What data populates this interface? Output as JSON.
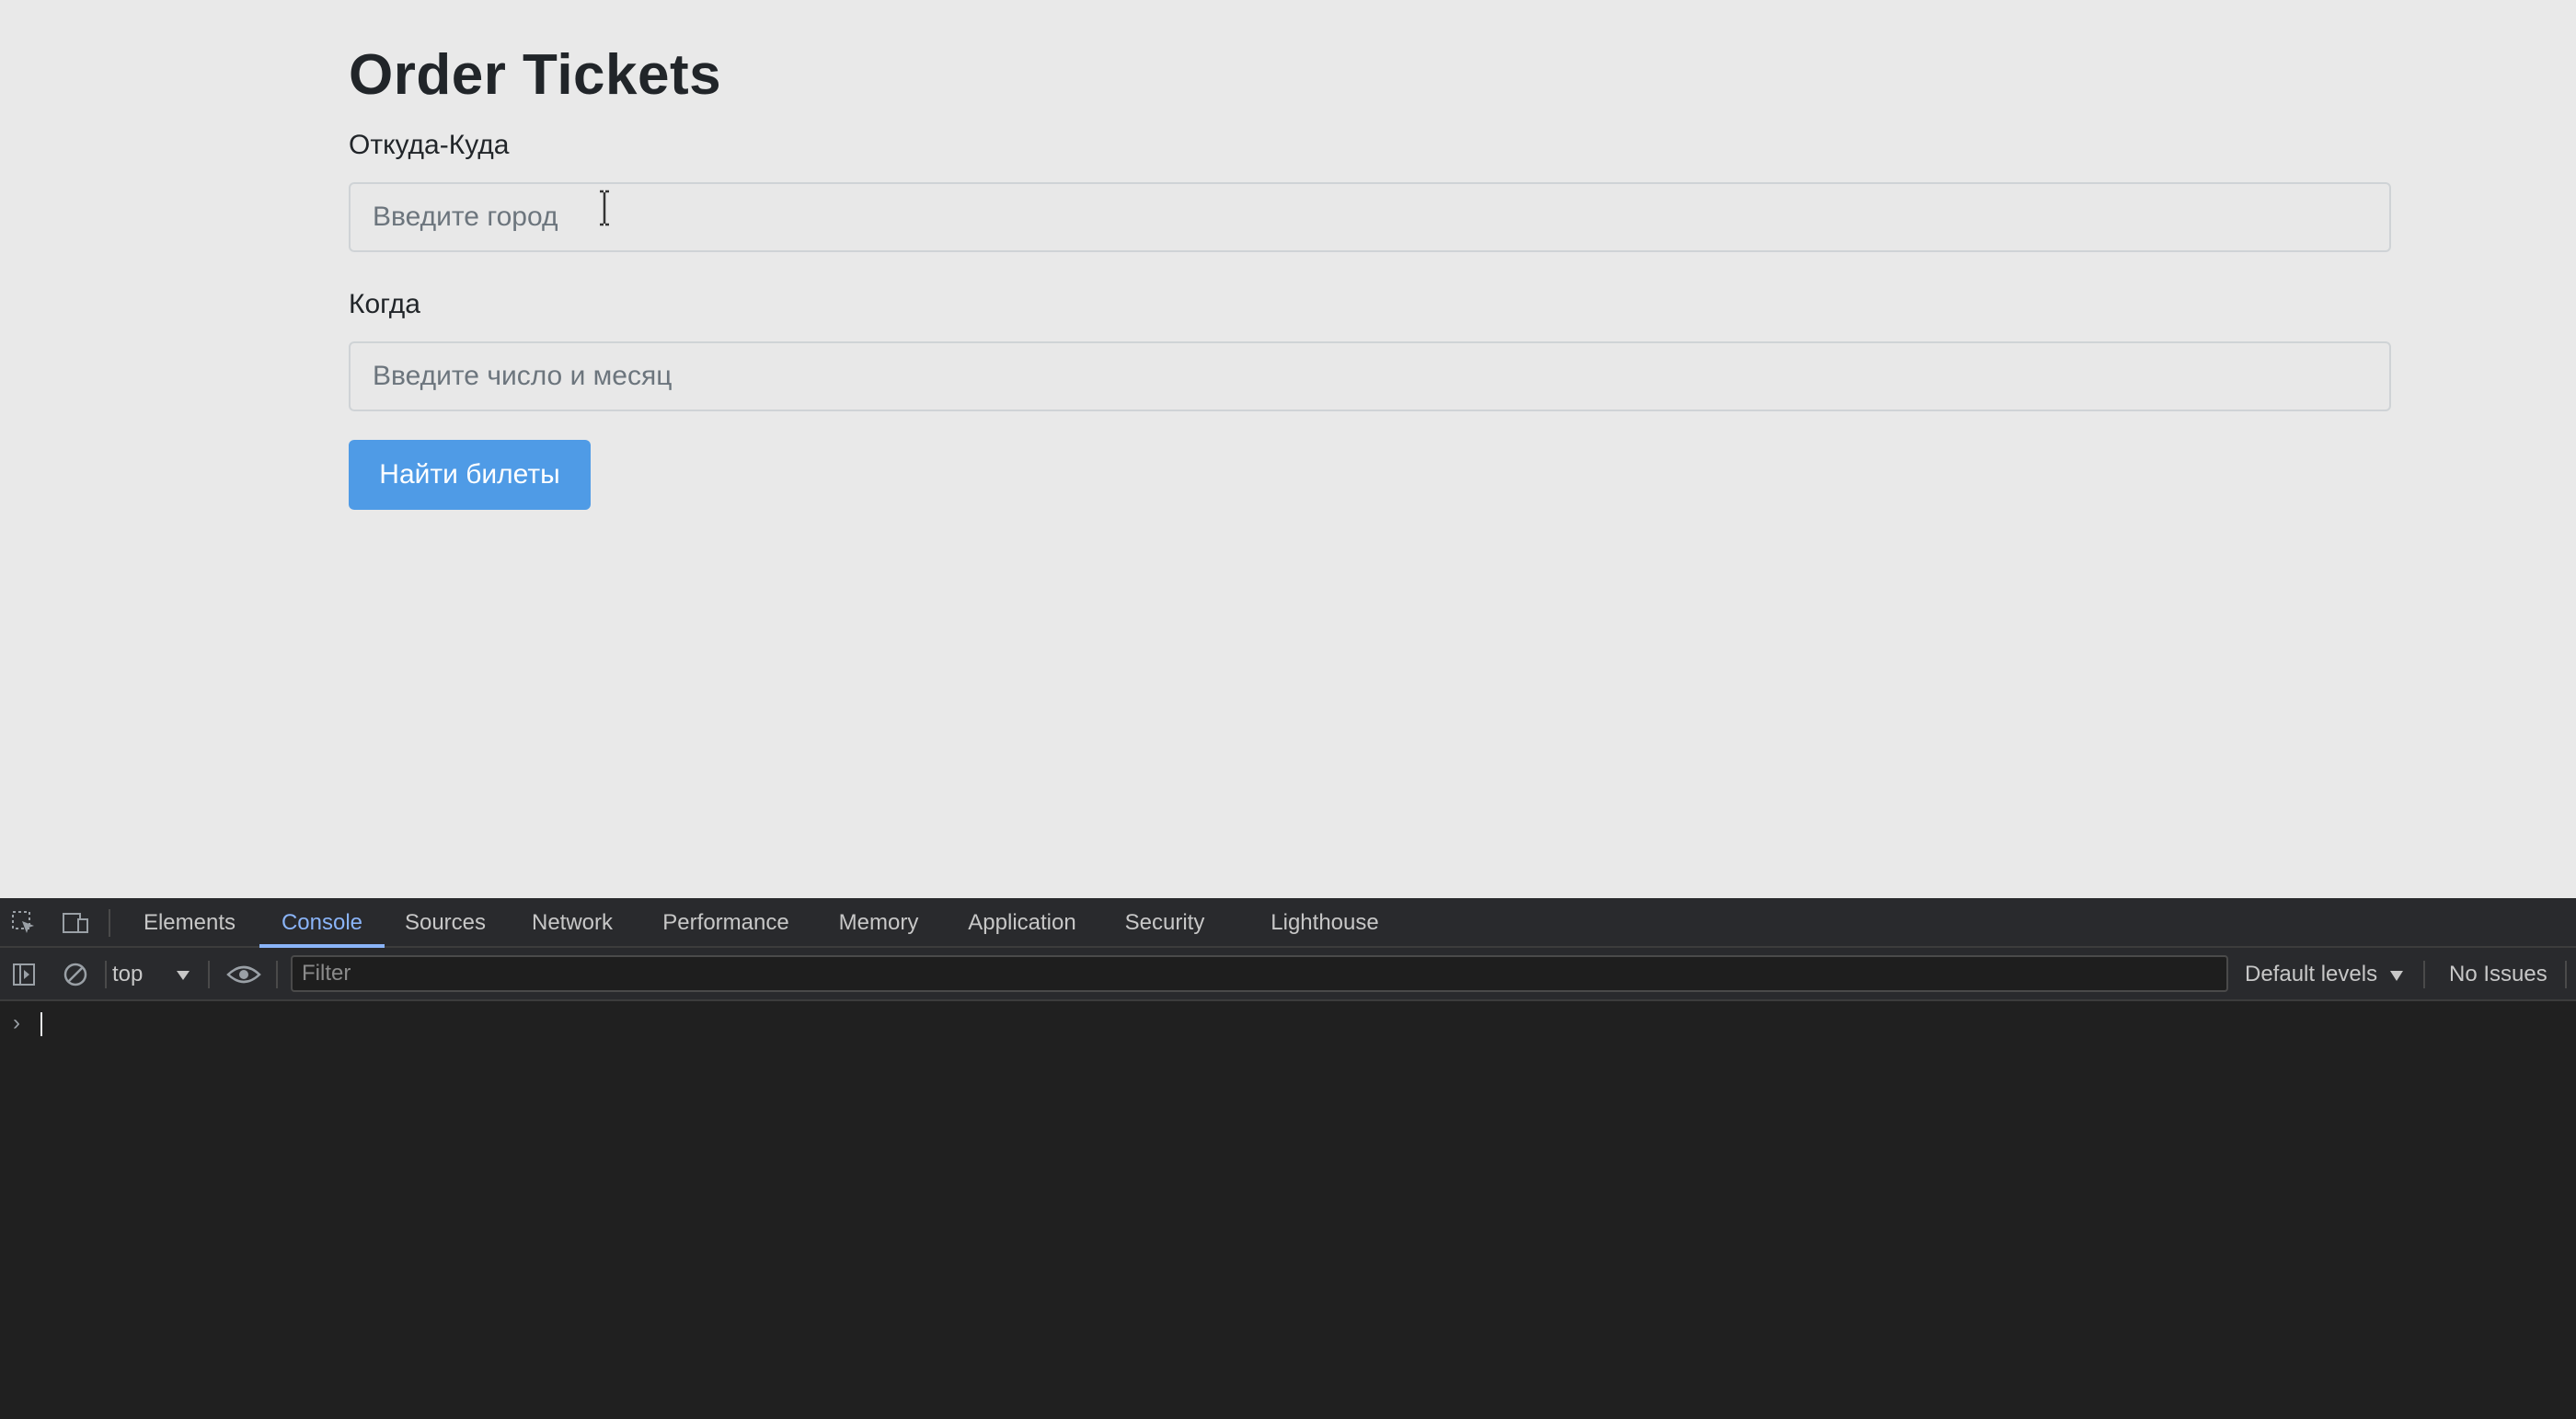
{
  "page": {
    "title": "Order Tickets",
    "from_to": {
      "label": "Откуда-Куда",
      "placeholder": "Введите город",
      "value": ""
    },
    "when": {
      "label": "Когда",
      "placeholder": "Введите число и месяц",
      "value": ""
    },
    "submit_label": "Найти билеты",
    "colors": {
      "background": "#e9e9e9",
      "button": "#4f9be6",
      "text": "#212529"
    }
  },
  "devtools": {
    "toolbar_icons": [
      "inspect-element-icon",
      "device-toggle-icon"
    ],
    "tabs": [
      {
        "label": "Elements",
        "active": false
      },
      {
        "label": "Console",
        "active": true
      },
      {
        "label": "Sources",
        "active": false
      },
      {
        "label": "Network",
        "active": false
      },
      {
        "label": "Performance",
        "active": false
      },
      {
        "label": "Memory",
        "active": false
      },
      {
        "label": "Application",
        "active": false
      },
      {
        "label": "Security",
        "active": false
      },
      {
        "label": "Lighthouse",
        "active": false
      }
    ],
    "console_toolbar": {
      "sidebar_icon": "sidebar-toggle-icon",
      "clear_icon": "clear-console-icon",
      "context": "top",
      "eye_icon": "live-expression-eye-icon",
      "filter_placeholder": "Filter",
      "levels": "Default levels",
      "issues": "No Issues"
    },
    "prompt": "›",
    "colors": {
      "panel": "#202020",
      "tabbar": "#292a2d",
      "active_tab": "#8ab4f8",
      "text": "#c7c7c7"
    }
  }
}
